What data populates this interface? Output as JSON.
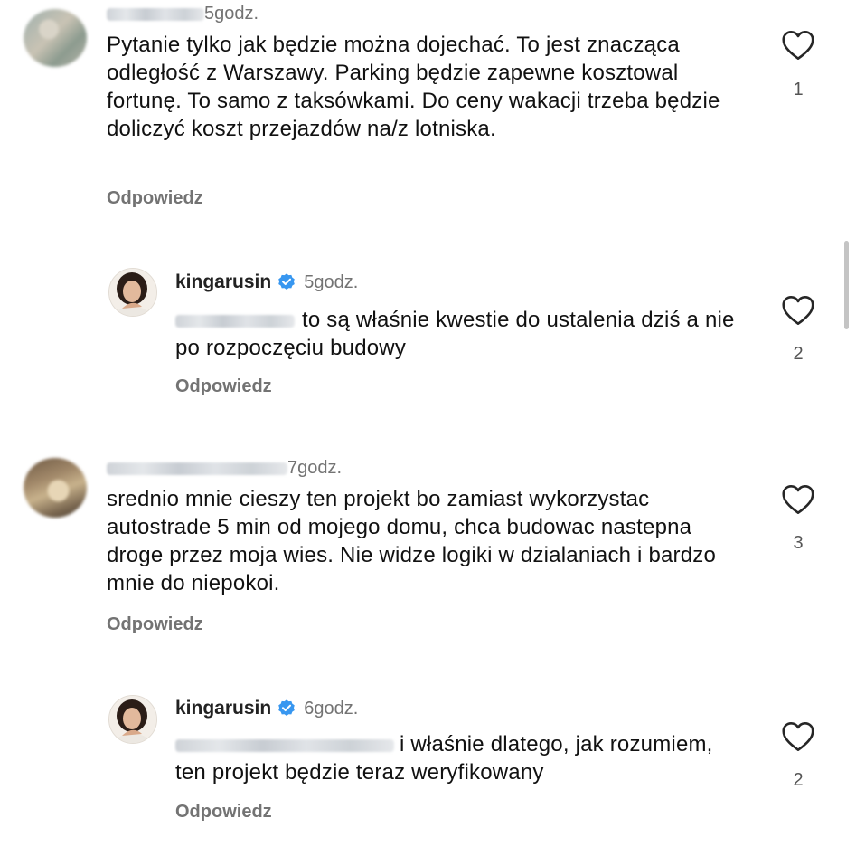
{
  "comments": [
    {
      "type": "comment",
      "time": "5godz.",
      "text": "Pytanie tylko jak będzie można dojechać. To jest znacząca odległość z Warszawy. Parking będzie zapewne kosztowal fortunę. To samo z taksówkami. Do ceny wakacji trzeba będzie doliczyć koszt przejazdów na/z lotniska.",
      "reply_label": "Odpowiedz",
      "likes": "1"
    },
    {
      "type": "reply",
      "username": "kingarusin",
      "verified": true,
      "time": "5godz.",
      "text": "to są właśnie kwestie do ustalenia dziś a nie po rozpoczęciu budowy",
      "reply_label": "Odpowiedz",
      "likes": "2"
    },
    {
      "type": "comment",
      "time": "7godz.",
      "text": "srednio mnie cieszy ten projekt bo zamiast wykorzystac autostrade 5 min od mojego domu, chca budowac nastepna droge przez moja wies.  Nie widze logiki w dzialaniach i bardzo mnie do niepokoi.",
      "reply_label": "Odpowiedz",
      "likes": "3"
    },
    {
      "type": "reply",
      "username": "kingarusin",
      "verified": true,
      "time": "6godz.",
      "text": "i właśnie dlatego, jak rozumiem, ten projekt będzie teraz weryfikowany",
      "reply_label": "Odpowiedz",
      "likes": "2"
    }
  ],
  "icons": {
    "like": "heart-outline-icon",
    "verified": "verified-badge-icon"
  },
  "colors": {
    "verified_blue": "#3897f0",
    "secondary_text": "#737373"
  }
}
